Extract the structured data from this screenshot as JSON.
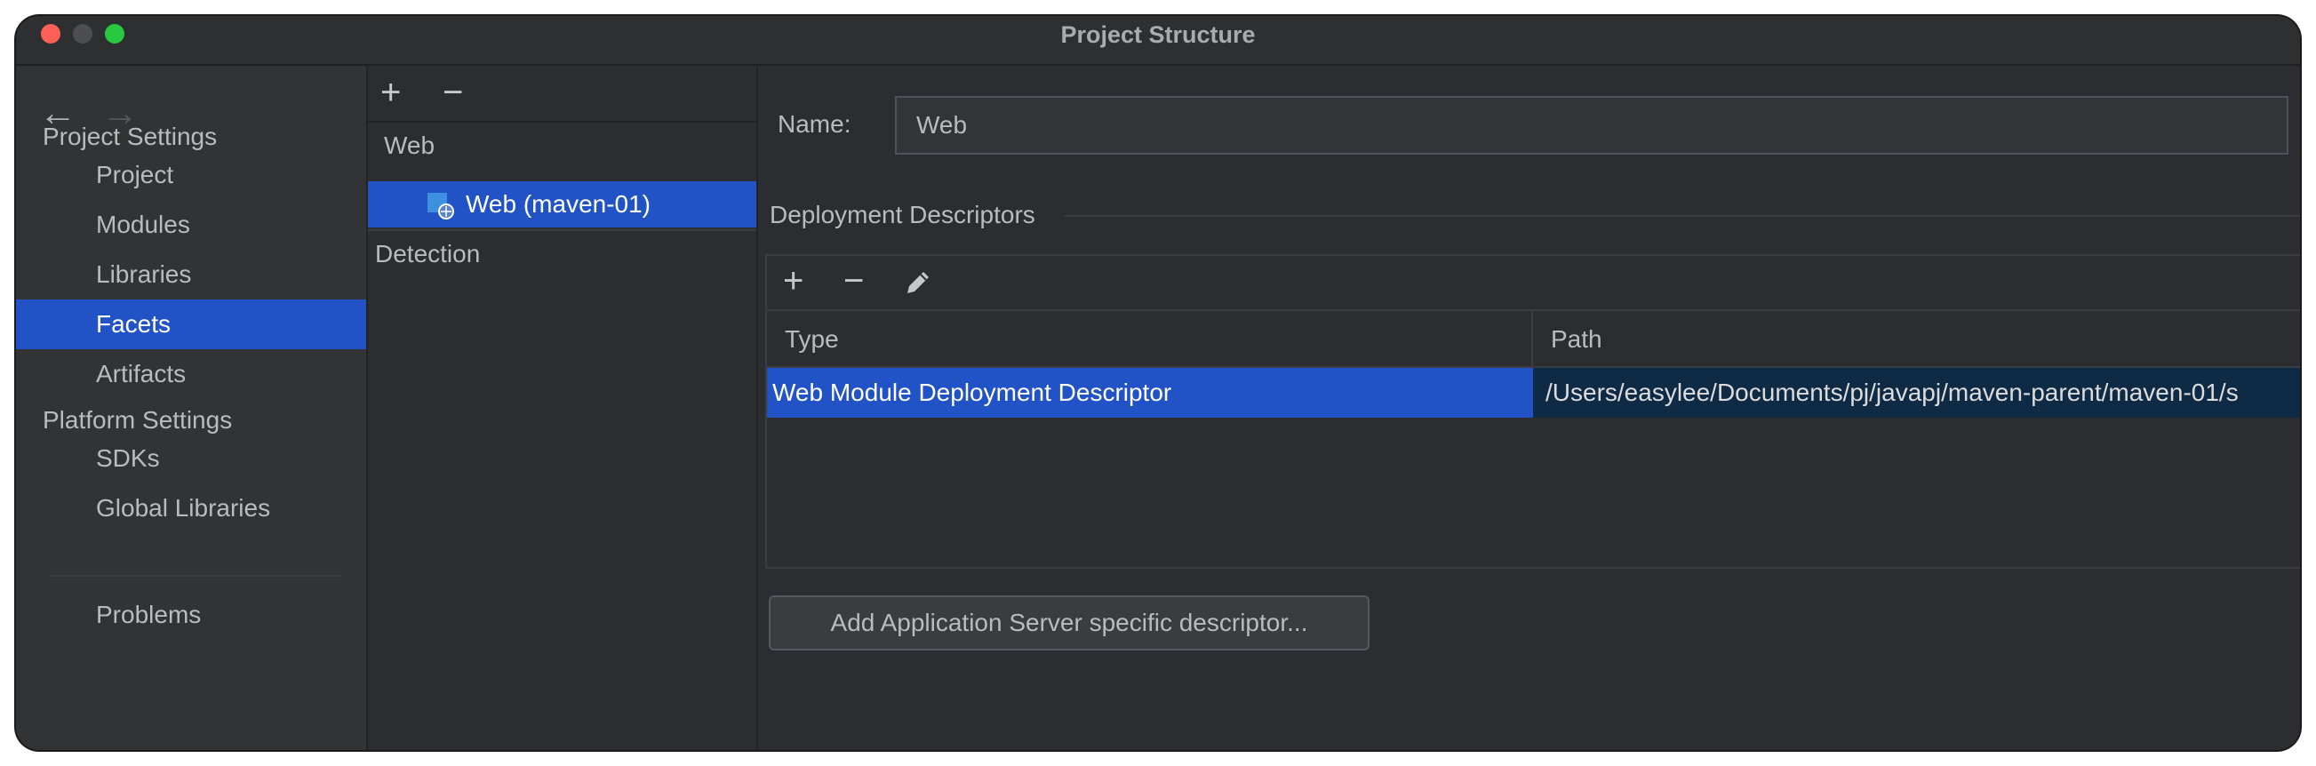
{
  "window": {
    "title": "Project Structure"
  },
  "sidebar": {
    "project_settings_label": "Project Settings",
    "items": [
      {
        "label": "Project"
      },
      {
        "label": "Modules"
      },
      {
        "label": "Libraries"
      },
      {
        "label": "Facets",
        "selected": true
      },
      {
        "label": "Artifacts"
      }
    ],
    "platform_settings_label": "Platform Settings",
    "platform_items": [
      {
        "label": "SDKs"
      },
      {
        "label": "Global Libraries"
      }
    ],
    "problems_label": "Problems"
  },
  "facets_tree": {
    "group_label": "Web",
    "selected_item_label": "Web (maven-01)",
    "detection_label": "Detection"
  },
  "detail": {
    "name_label": "Name:",
    "name_value": "Web",
    "deployment_descriptors_label": "Deployment Descriptors",
    "table": {
      "columns": [
        "Type",
        "Path"
      ],
      "rows": [
        {
          "type": "Web Module Deployment Descriptor",
          "path": "/Users/easylee/Documents/pj/javapj/maven-parent/maven-01/s"
        }
      ]
    },
    "add_server_descriptor_button": "Add Application Server specific descriptor..."
  },
  "colors": {
    "selection": "#2152c6",
    "background": "#2b2d30",
    "close": "#fe5f57",
    "maximize": "#28c840"
  }
}
